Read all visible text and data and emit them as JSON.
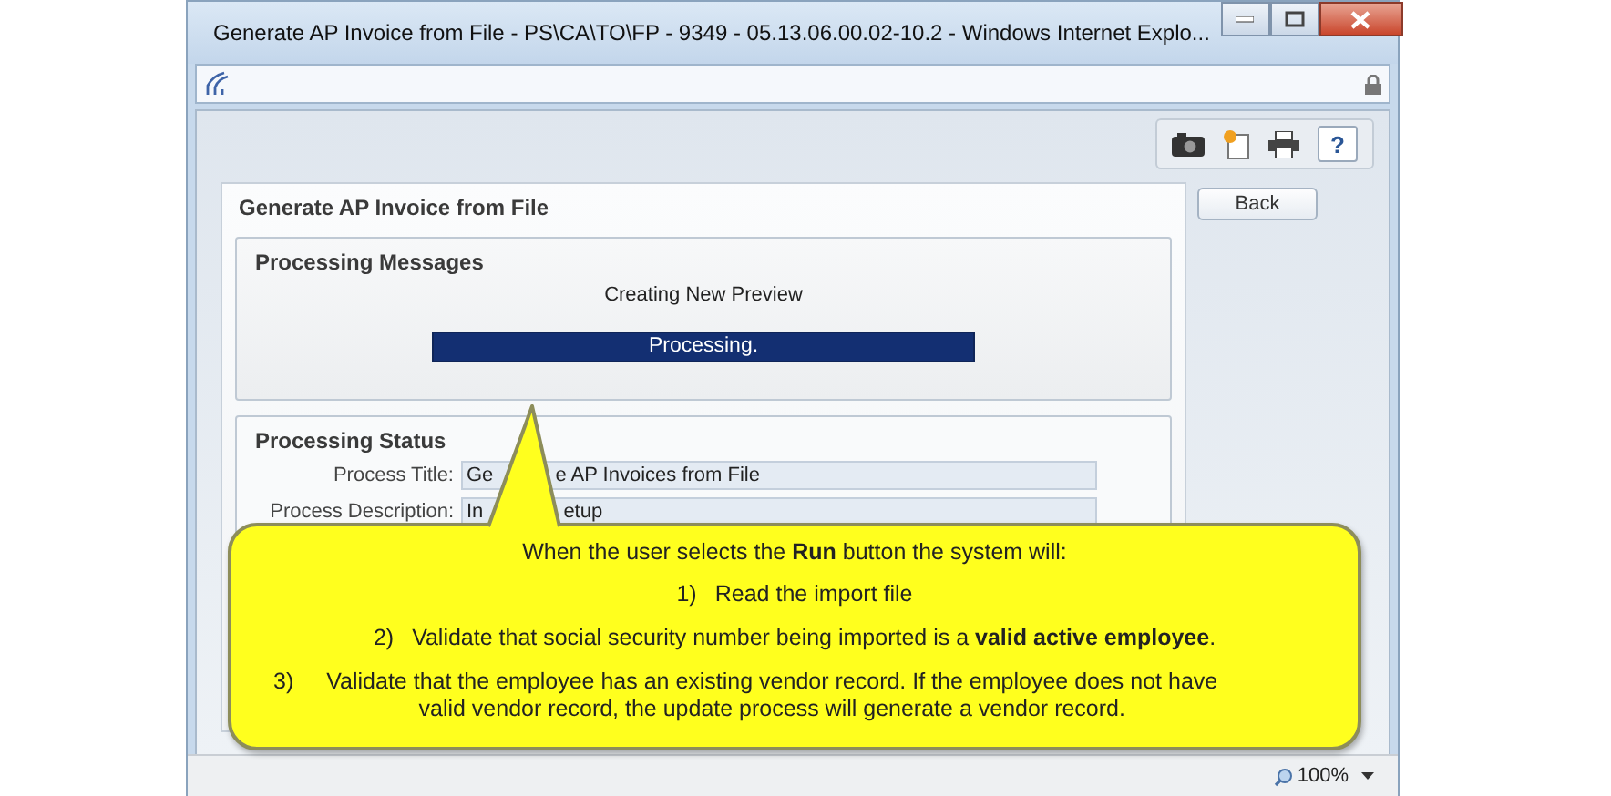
{
  "window": {
    "title": "Generate AP Invoice from File - PS\\CA\\TO\\FP - 9349 - 05.13.06.00.02-10.2 - Windows Internet Explo..."
  },
  "toolbar": {
    "help_label": "?"
  },
  "page": {
    "title": "Generate AP Invoice from File",
    "back_button": "Back",
    "messages": {
      "title": "Processing Messages",
      "message": "Creating New Preview",
      "progress": {
        "label": "Processing.",
        "level": 1
      }
    },
    "status": {
      "title": "Processing Status",
      "fields": [
        {
          "label": "Process Title:",
          "value_parts": [
            "Ge",
            "e AP Invoices from File"
          ]
        },
        {
          "label": "Process Description:",
          "value_parts": [
            "In",
            "etup"
          ]
        }
      ]
    }
  },
  "callout": {
    "intro": "When the user selects the **Run** button the system will:",
    "items": [
      {
        "number": "1)",
        "text": "Read the import file"
      },
      {
        "number": "2)",
        "text": "Validate that social security number being imported is a **valid active employee**."
      },
      {
        "number": "3)",
        "text": "Validate that the employee has an existing vendor record.  If the employee does not have valid vendor record, the update process will generate a vendor record."
      }
    ]
  },
  "status_bar": {
    "zoom": "100%"
  }
}
